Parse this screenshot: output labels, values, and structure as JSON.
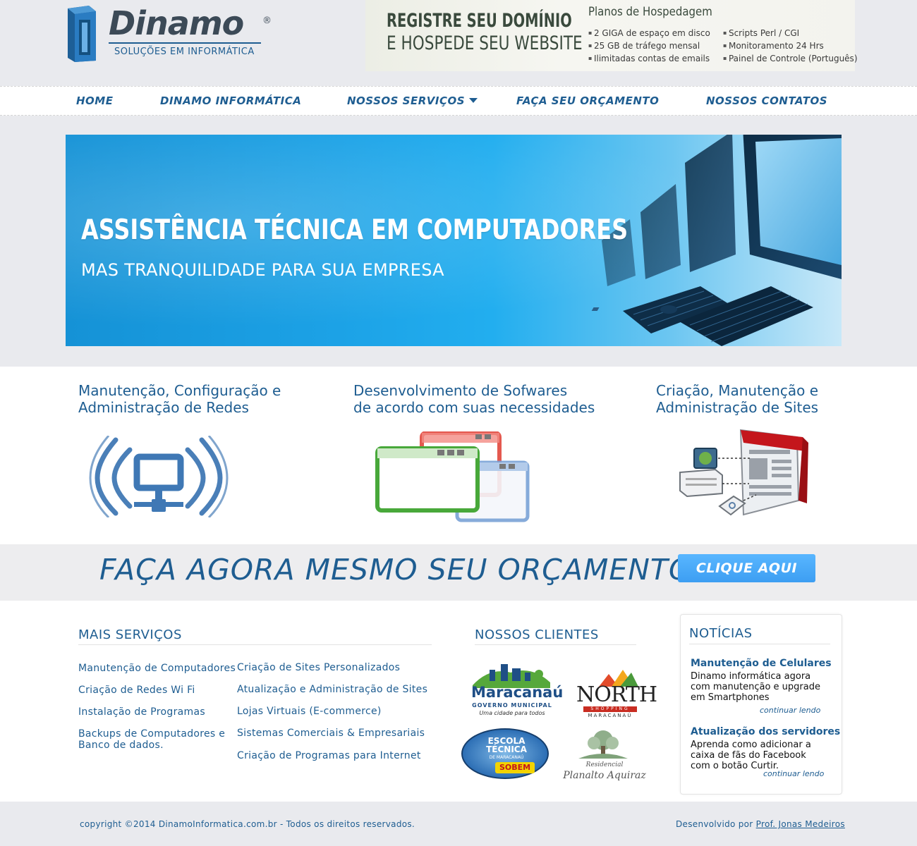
{
  "header": {
    "logo": {
      "name": "Dinamo",
      "registered": "®",
      "tagline": "SOLUÇÕES EM INFORMÁTICA"
    },
    "ad": {
      "title_line1": "REGISTRE SEU DOMÍNIO",
      "title_line2": "E HOSPEDE SEU WEBSITE",
      "plans_title": "Planos de Hospedagem",
      "col1": [
        "2 GIGA de espaço em disco",
        "25 GB de tráfego mensal",
        "Ilimitadas contas de emails"
      ],
      "col2": [
        "Scripts Perl / CGI",
        "Monitoramento 24 Hrs",
        "Painel de Controle (Português)"
      ]
    }
  },
  "nav": {
    "items": [
      {
        "label": "HOME"
      },
      {
        "label": "DINAMO INFORMÁTICA"
      },
      {
        "label": "NOSSOS SERVIÇOS",
        "icon": "caret-down-icon"
      },
      {
        "label": "FAÇA SEU ORÇAMENTO"
      },
      {
        "label": "NOSSOS CONTATOS"
      }
    ]
  },
  "banner": {
    "title": "ASSISTÊNCIA TÉCNICA EM COMPUTADORES",
    "subtitle": "MAS TRANQUILIDADE PARA SUA EMPRESA"
  },
  "services": [
    {
      "line1": "Manutenção, Configuração e",
      "line2": "Administração de Redes",
      "icon": "network-wireless-icon"
    },
    {
      "line1": "Desenvolvimento de Sofwares",
      "line2": "de acordo com suas necessidades",
      "icon": "software-windows-icon"
    },
    {
      "line1": "Criação, Manutenção e",
      "line2": "Administração de Sites",
      "icon": "website-icon"
    }
  ],
  "cta": {
    "text": "FAÇA AGORA MESMO SEU ORÇAMENTO",
    "button": "CLIQUE AQUI"
  },
  "more_services": {
    "heading": "MAIS SERVIÇOS",
    "col1": [
      "Manutenção de Computadores",
      "Criação de Redes Wi Fi",
      "Instalação de Programas",
      "Backups de Computadores e",
      "Banco de dados."
    ],
    "col2": [
      "Criação de Sites Personalizados",
      "Atualização e Administração de Sites",
      "Lojas Virtuais (E-commerce)",
      "Sistemas Comerciais & Empresariais",
      "Criação de Programas para Internet"
    ]
  },
  "clients": {
    "heading": "NOSSOS CLIENTES",
    "logos": [
      {
        "name": "Maracanaú",
        "line2": "GOVERNO MUNICIPAL",
        "line3": "Uma cidade para todos"
      },
      {
        "name": "NORTH",
        "line2": "SHOPPING",
        "line3": "MARACANAÚ"
      },
      {
        "name": "ESCOLA TÉCNICA",
        "line2": "DE MARACANAÚ",
        "line3": "SOBEM"
      },
      {
        "name": "Residencial",
        "line2": "Planalto Aquiraz"
      }
    ]
  },
  "news": {
    "heading": "NOTÍCIAS",
    "items": [
      {
        "title": "Manutenção de Celulares",
        "body": "Dinamo informática agora com manutenção e upgrade em Smartphones",
        "more": "continuar lendo"
      },
      {
        "title": "Atualização dos servidores",
        "body": "Aprenda como adicionar a caixa de fãs do Facebook com o botão Curtir.",
        "more": "continuar lendo"
      }
    ]
  },
  "footer": {
    "copyright": "copyright ©2014 DinamoInformatica.com.br - Todos os direitos reservados.",
    "developed_by": "Desenvolvido por",
    "developer": "Prof. Jonas Medeiros"
  },
  "colors": {
    "primary": "#1e5d91",
    "cta_button": "#4aa9f8",
    "banner": "#1ca2e6",
    "page_bg": "#e9eaee"
  }
}
